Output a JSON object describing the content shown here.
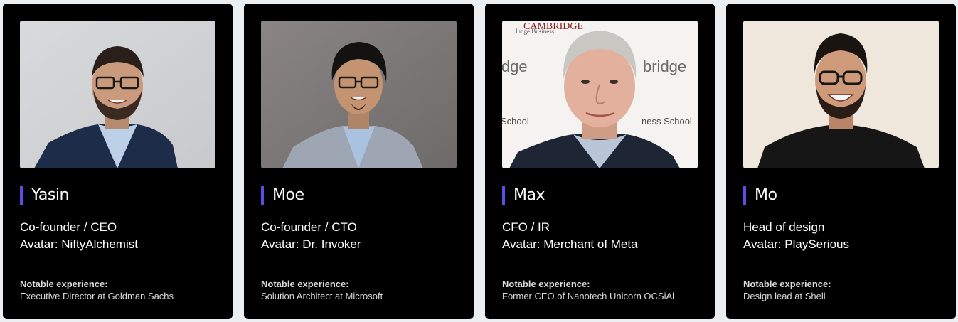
{
  "team": [
    {
      "name": "Yasin",
      "role": "Co-founder / CEO",
      "avatar": "Avatar: NiftyAlchemist",
      "experience_label": "Notable experience:",
      "experience": "Executive Director at Goldman Sachs",
      "photo": "portrait-photo"
    },
    {
      "name": "Moe",
      "role": "Co-founder / CTO",
      "avatar": "Avatar: Dr. Invoker",
      "experience_label": "Notable experience:",
      "experience": "Solution Architect at Microsoft",
      "photo": "portrait-photo"
    },
    {
      "name": "Max",
      "role": "CFO / IR",
      "avatar": "Avatar: Merchant of Meta",
      "experience_label": "Notable experience:",
      "experience": "Former CEO of Nanotech Unicorn OCSiAl",
      "photo": "portrait-photo",
      "photo_backdrop_text": [
        "CAMBRIDGE",
        "Judge Business",
        "idge",
        "bridge",
        "School",
        "ness School"
      ]
    },
    {
      "name": "Mo",
      "role": "Head of design",
      "avatar": "Avatar: PlaySerious",
      "experience_label": "Notable experience:",
      "experience": "Design lead at Shell",
      "photo": "portrait-photo"
    }
  ],
  "colors": {
    "card_bg": "#000000",
    "accent_bar": "#5b4de6",
    "page_bg": "#eceff2",
    "text": "#ffffff",
    "muted_text": "#d9d9d9"
  }
}
